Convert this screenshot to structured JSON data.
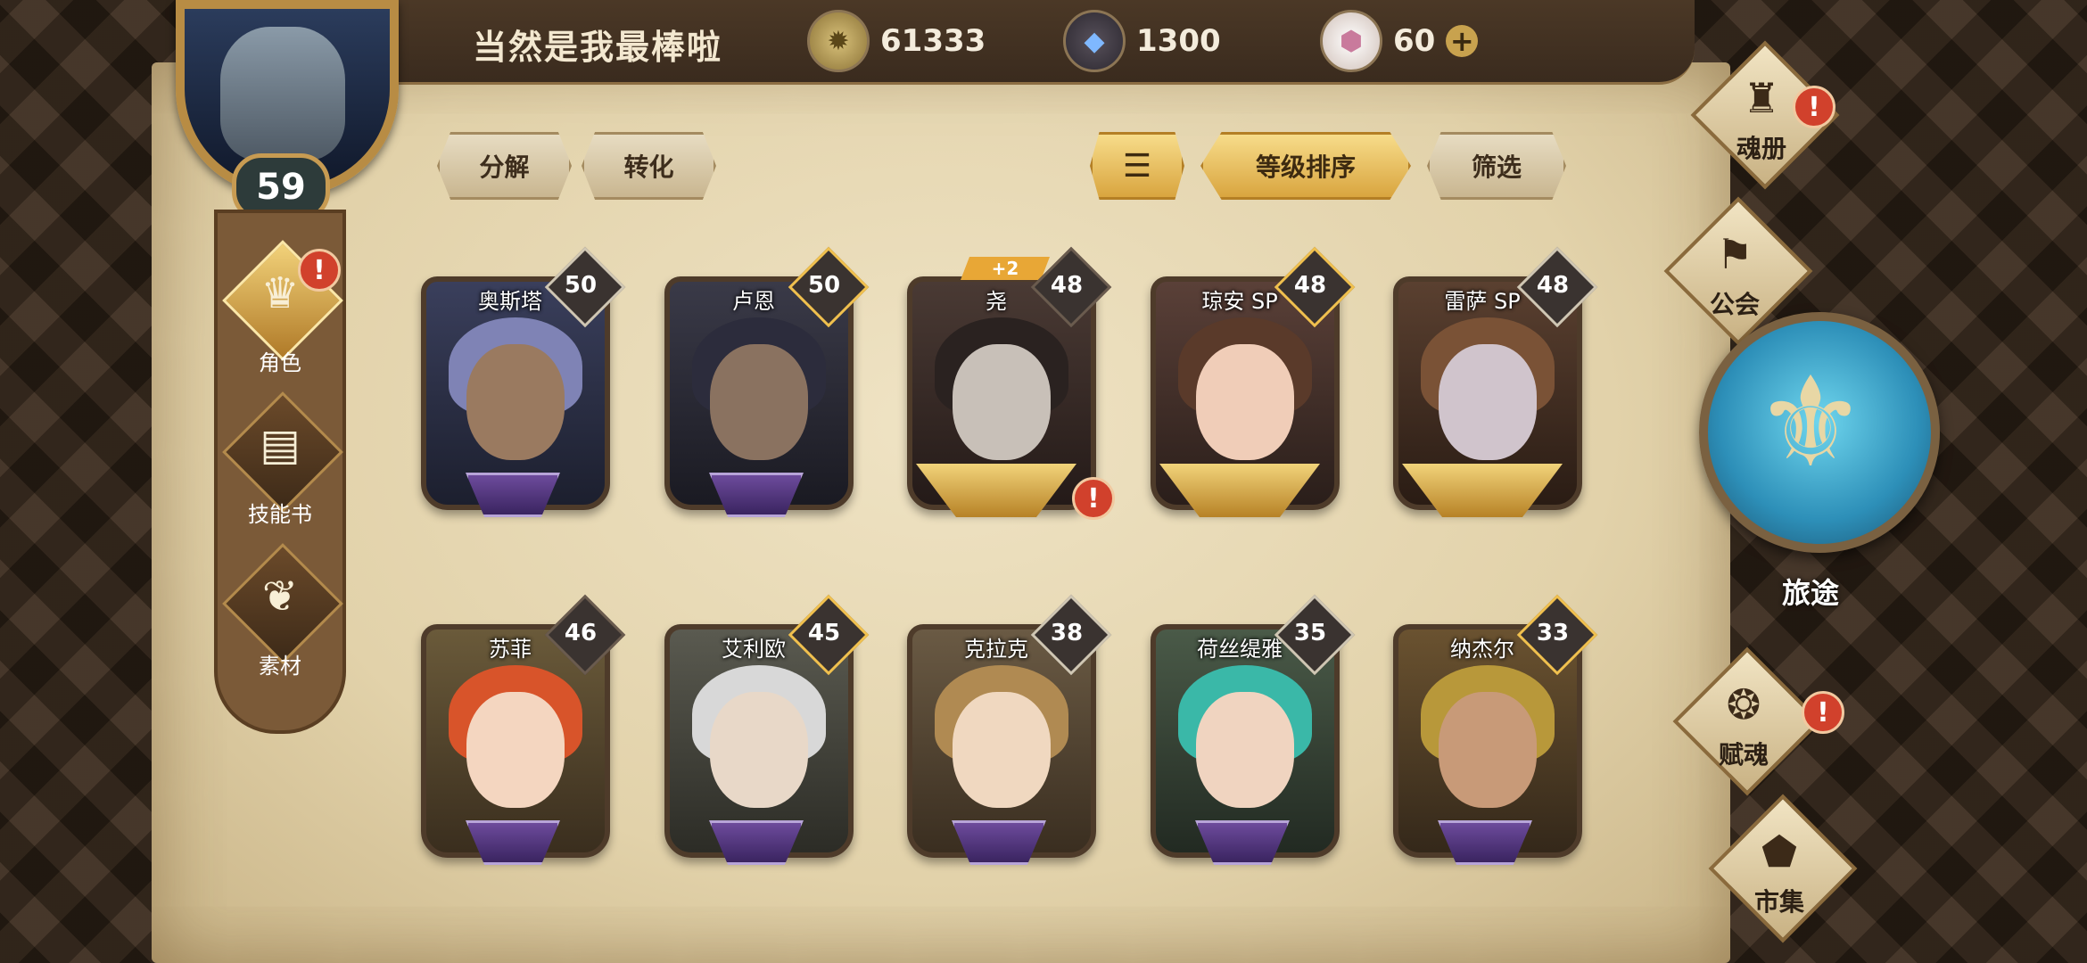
{
  "player": {
    "name": "当然是我最棒啦",
    "level": "59"
  },
  "resources": [
    {
      "icon": "coin-icon",
      "value": "61333"
    },
    {
      "icon": "crystal-icon",
      "value": "1300"
    },
    {
      "icon": "gem-icon",
      "value": "60"
    }
  ],
  "sidebar": {
    "items": [
      {
        "label": "角色",
        "icon": "helmet-icon"
      },
      {
        "label": "技能书",
        "icon": "book-icon"
      },
      {
        "label": "素材",
        "icon": "material-icon"
      }
    ]
  },
  "toolbar": {
    "decompose": "分解",
    "convert": "转化",
    "sort_level": "等级排序",
    "filter": "筛选"
  },
  "heroes": [
    {
      "name": "奥斯塔",
      "level": "50"
    },
    {
      "name": "卢恩",
      "level": "50"
    },
    {
      "name": "尧",
      "level": "48",
      "badge": "+2"
    },
    {
      "name": "琼安 SP",
      "level": "48"
    },
    {
      "name": "雷萨 SP",
      "level": "48"
    },
    {
      "name": "苏菲",
      "level": "46"
    },
    {
      "name": "艾利欧",
      "level": "45"
    },
    {
      "name": "克拉克",
      "level": "38"
    },
    {
      "name": "荷丝缇雅",
      "level": "35"
    },
    {
      "name": "纳杰尔",
      "level": "33"
    }
  ],
  "right_nav": {
    "soul_book": "魂册",
    "guild": "公会",
    "journey": "旅途",
    "endow": "赋魂",
    "market": "市集"
  }
}
